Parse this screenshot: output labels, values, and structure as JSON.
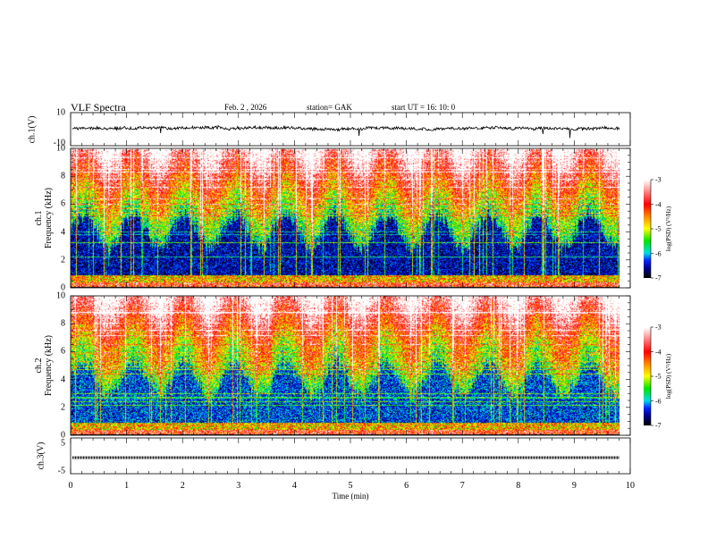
{
  "header": {
    "title": "VLF  Spectra",
    "date": "Feb. 2  , 2026",
    "station": "station= GAK",
    "start_ut": "start  UT  =    16: 10: 0"
  },
  "chart_data": [
    {
      "type": "line",
      "ylabel": "ch.1(V)",
      "ylim": [
        -10,
        10
      ],
      "yticks": [
        "10",
        "-10"
      ],
      "xlim": [
        0,
        10
      ]
    },
    {
      "type": "heatmap",
      "ylabel": "ch.1\nFrequency (kHz)",
      "ylabel_lines": [
        "ch.1",
        "Frequency  (kHz)"
      ],
      "ylim": [
        0,
        10
      ],
      "yticks": [
        "0",
        "2",
        "4",
        "6",
        "8",
        "10"
      ],
      "xlim": [
        0,
        10
      ],
      "colorbar": {
        "label": "log(PSD) (V²/Hz)",
        "range": [
          -7,
          -3
        ],
        "ticks": [
          "-3",
          "-4",
          "-5",
          "-6",
          "-7"
        ]
      }
    },
    {
      "type": "heatmap",
      "ylabel_lines": [
        "ch.2",
        "Frequency  (kHz)"
      ],
      "ylim": [
        0,
        10
      ],
      "yticks": [
        "0",
        "2",
        "4",
        "6",
        "8",
        "10"
      ],
      "xlim": [
        0,
        10
      ],
      "colorbar": {
        "label": "log(PSD) (V²/Hz)",
        "range": [
          -7,
          -3
        ],
        "ticks": [
          "-3",
          "-4",
          "-5",
          "-6",
          "-7"
        ]
      }
    },
    {
      "type": "line",
      "ylabel": "ch.3(V)",
      "ylim": [
        -5,
        5
      ],
      "yticks": [
        "5",
        "-5"
      ],
      "xlim": [
        0,
        10
      ],
      "approx_level": -1.7
    }
  ],
  "xaxis": {
    "label": "Time  (min)",
    "ticks": [
      "0",
      "1",
      "2",
      "3",
      "4",
      "5",
      "6",
      "7",
      "8",
      "9",
      "10"
    ]
  },
  "colors": {
    "colormap": [
      "#000000",
      "#0000c0",
      "#0060ff",
      "#00e0e0",
      "#00e000",
      "#ffff00",
      "#ff8000",
      "#ff0000",
      "#ffffff"
    ]
  }
}
